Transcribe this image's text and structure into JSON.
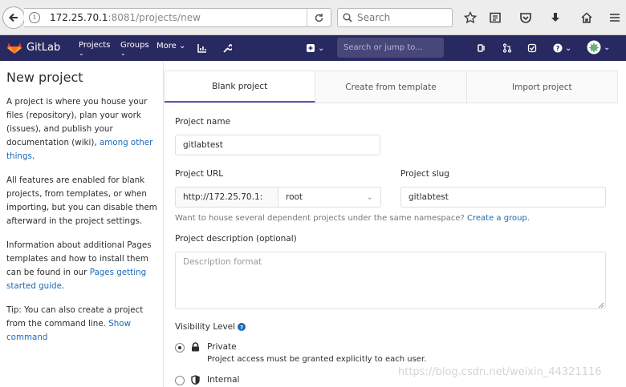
{
  "browser": {
    "url_host": "172.25.70.1",
    "url_path": ":8081/projects/new",
    "search_placeholder": "Search"
  },
  "gitlab_nav": {
    "brand": "GitLab",
    "projects": "Projects",
    "groups": "Groups",
    "more": "More",
    "search_placeholder": "Search or jump to..."
  },
  "sidebar": {
    "title": "New project",
    "p1_text": "A project is where you house your files (repository), plan your work (issues), and publish your documentation (wiki), ",
    "p1_link": "among other things",
    "p1_end": ".",
    "p2": "All features are enabled for blank projects, from templates, or when importing, but you can disable them afterward in the project settings.",
    "p3_text": "Information about additional Pages templates and how to install them can be found in our ",
    "p3_link": "Pages getting started guide",
    "p3_end": ".",
    "p4_text": "Tip: You can also create a project from the command line. ",
    "p4_link": "Show command"
  },
  "tabs": {
    "blank": "Blank project",
    "template": "Create from template",
    "import": "Import project"
  },
  "form": {
    "name_label": "Project name",
    "name_value": "gitlabtest",
    "url_label": "Project URL",
    "url_prefix": "http://172.25.70.1:",
    "namespace": "root",
    "slug_label": "Project slug",
    "slug_value": "gitlabtest",
    "help_text": "Want to house several dependent projects under the same namespace? ",
    "help_link": "Create a group.",
    "desc_label": "Project description (optional)",
    "desc_placeholder": "Description format",
    "visibility_label": "Visibility Level",
    "private_label": "Private",
    "private_desc": "Project access must be granted explicitly to each user.",
    "internal_label": "Internal",
    "selected_visibility": "Private"
  },
  "watermark": "https://blog.csdn.net/weixin_44321116"
}
